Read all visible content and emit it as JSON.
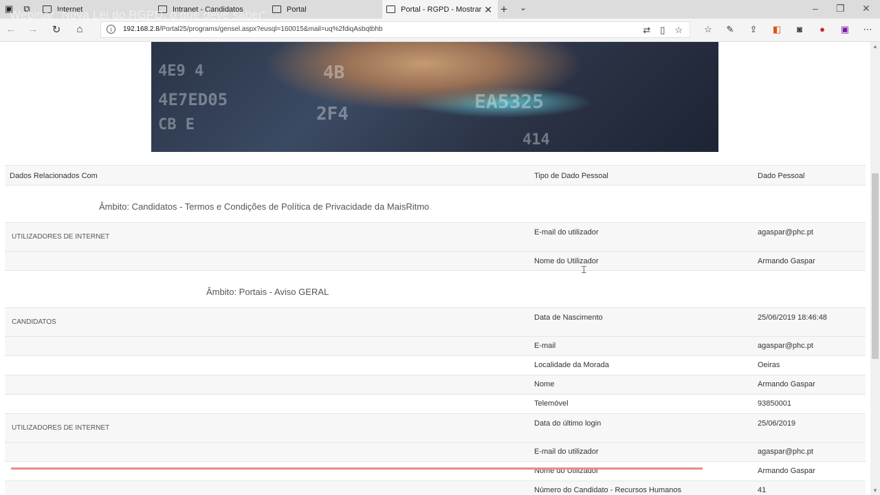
{
  "browser": {
    "tabs": [
      {
        "label": "Internet",
        "active": false
      },
      {
        "label": "Intranet - Candidatos",
        "active": false
      },
      {
        "label": "Portal",
        "active": false
      },
      {
        "label": "Portal - RGPD - Mostrar",
        "active": true
      }
    ],
    "watermark": "Webinar \"Nova Lei do RGPD, o que deve saber\"",
    "url_host": "192.168.2.8",
    "url_path": "/Portal25/programs/gensel.aspx?eusql=160015&mail=uq%2fdiqAsbqtbhb",
    "accent": "#e88a86"
  },
  "table": {
    "headers": [
      "Dados Relacionados Com",
      "Tipo de Dado Pessoal",
      "Dado Pessoal"
    ],
    "sections": [
      {
        "title": "Âmbito: Candidatos - Termos e Condições de Política de Privacidade da MaisRitmo",
        "groups": [
          {
            "name": "UTILIZADORES DE INTERNET",
            "rows": [
              {
                "tipo": "E-mail do utilizador",
                "dado": "agaspar@phc.pt"
              },
              {
                "tipo": "Nome do Utilizador",
                "dado": "Armando Gaspar"
              }
            ]
          }
        ]
      },
      {
        "title": "Âmbito: Portais - Aviso GERAL",
        "groups": [
          {
            "name": "CANDIDATOS",
            "rows": [
              {
                "tipo": "Data de Nascimento",
                "dado": "25/06/2019 18:46:48"
              },
              {
                "tipo": "E-mail",
                "dado": "agaspar@phc.pt"
              },
              {
                "tipo": "Localidade da Morada",
                "dado": "Oeiras"
              },
              {
                "tipo": "Nome",
                "dado": "Armando Gaspar"
              },
              {
                "tipo": "Telemóvel",
                "dado": "93850001"
              }
            ]
          },
          {
            "name": "UTILIZADORES DE INTERNET",
            "rows": [
              {
                "tipo": "Data do último login",
                "dado": "25/06/2019"
              },
              {
                "tipo": "E-mail do utilizador",
                "dado": "agaspar@phc.pt"
              },
              {
                "tipo": "Nome do Utilizador",
                "dado": "Armando Gaspar"
              },
              {
                "tipo": "Número do Candidato - Recursos Humanos",
                "dado": "41"
              }
            ]
          }
        ]
      }
    ]
  }
}
